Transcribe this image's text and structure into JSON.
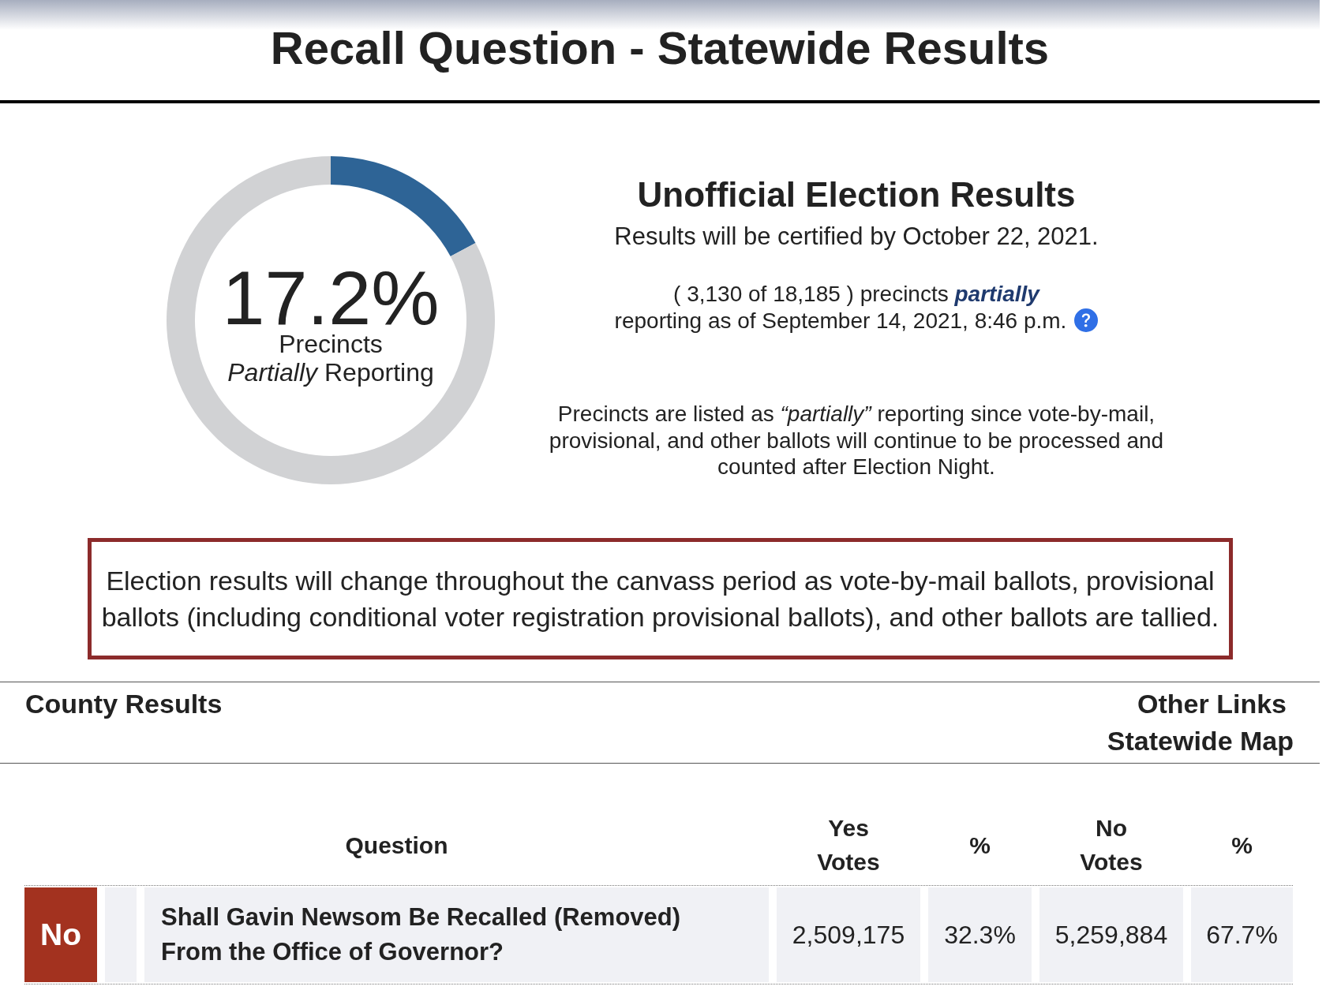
{
  "header": {
    "title": "Recall Question - Statewide Results"
  },
  "reporting_gauge": {
    "chart_data": {
      "type": "donut",
      "values": [
        17.2,
        82.8
      ]
    },
    "percent": "17.2%",
    "caption_lines": [
      "Precincts",
      "*Partially* Reporting"
    ]
  },
  "summary": {
    "heading": "Unofficial Election Results",
    "certification": "Results will be certified by October 22, 2021.",
    "status_lines": [
      "( 3,130 of 18,185 ) precincts **partially**",
      "reporting as of September 14, 2021, 8:46 p.m."
    ],
    "note_lines": [
      "Precincts are listed as *“partially”* reporting since vote-by-mail,",
      "provisional, and other ballots will continue to be processed and",
      "counted after Election Night."
    ]
  },
  "notice": {
    "lines": [
      "Election results will change throughout the canvass period as vote-by-mail ballots, provisional",
      "ballots (including conditional voter registration provisional ballots), and other ballots are tallied."
    ]
  },
  "links_bar": {
    "county_results": "County Results",
    "other_links": {
      "title": "Other Links",
      "items": [
        "Statewide Map"
      ]
    }
  },
  "results_table": {
    "columns": [
      "Question",
      "Yes Votes",
      "%",
      "No Votes",
      "%"
    ],
    "rows": [
      {
        "outcome": "No",
        "question": "Shall Gavin Newsom Be Recalled (Removed) From the Office of Governor?",
        "yes_votes": "2,509,175",
        "yes_percent": "32.3%",
        "no_votes": "5,259,884",
        "no_percent": "67.7%"
      }
    ]
  }
}
